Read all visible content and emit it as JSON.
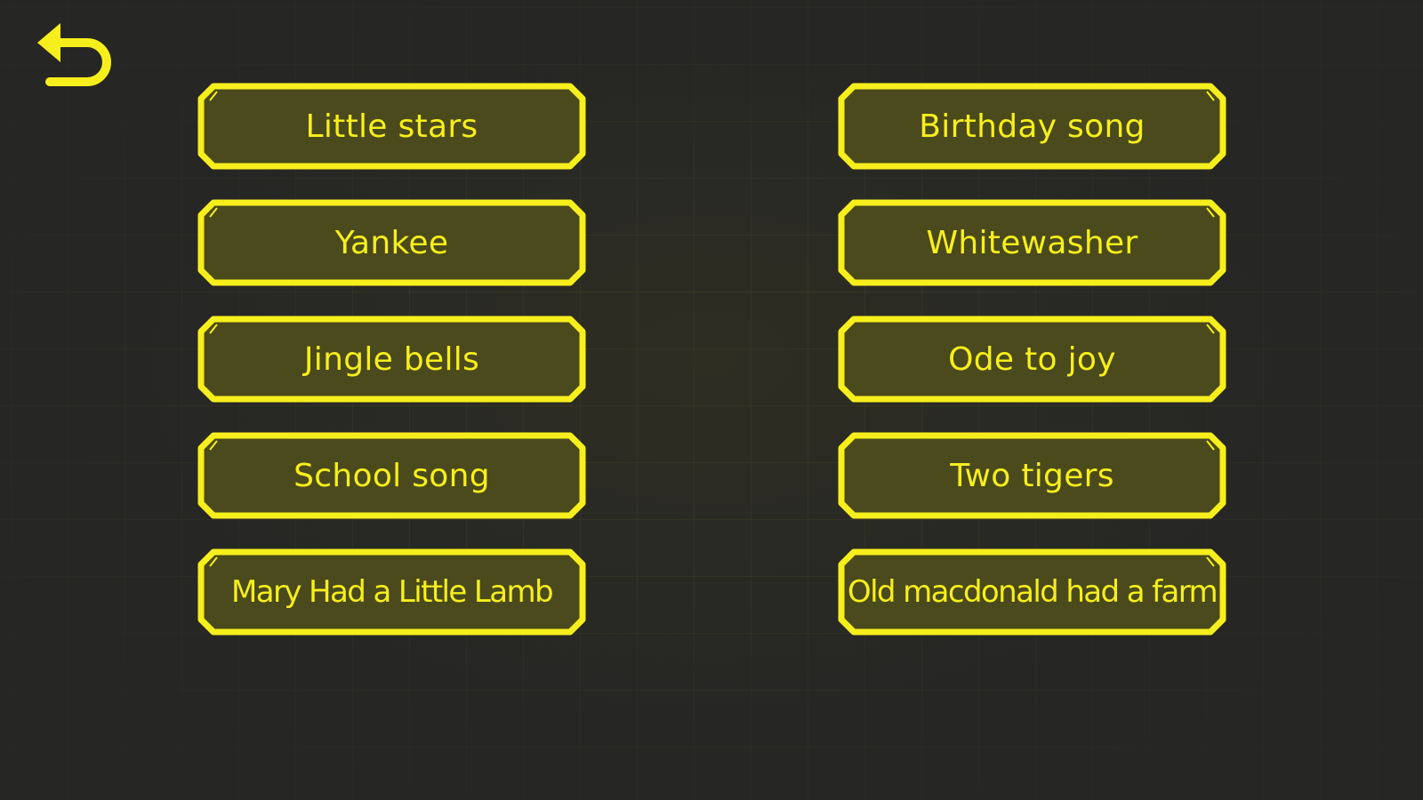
{
  "back_button": {
    "icon": "undo-arrow-icon"
  },
  "songs": {
    "left": [
      "Little stars",
      "Yankee",
      "Jingle bells",
      "School song",
      "Mary Had a Little Lamb"
    ],
    "right": [
      "Birthday song",
      "Whitewasher",
      "Ode to joy",
      "Two tigers",
      "Old macdonald had a farm"
    ]
  },
  "colors": {
    "accent": "#f7ef1c",
    "button_fill": "#4b4a1c",
    "background": "#262625"
  }
}
